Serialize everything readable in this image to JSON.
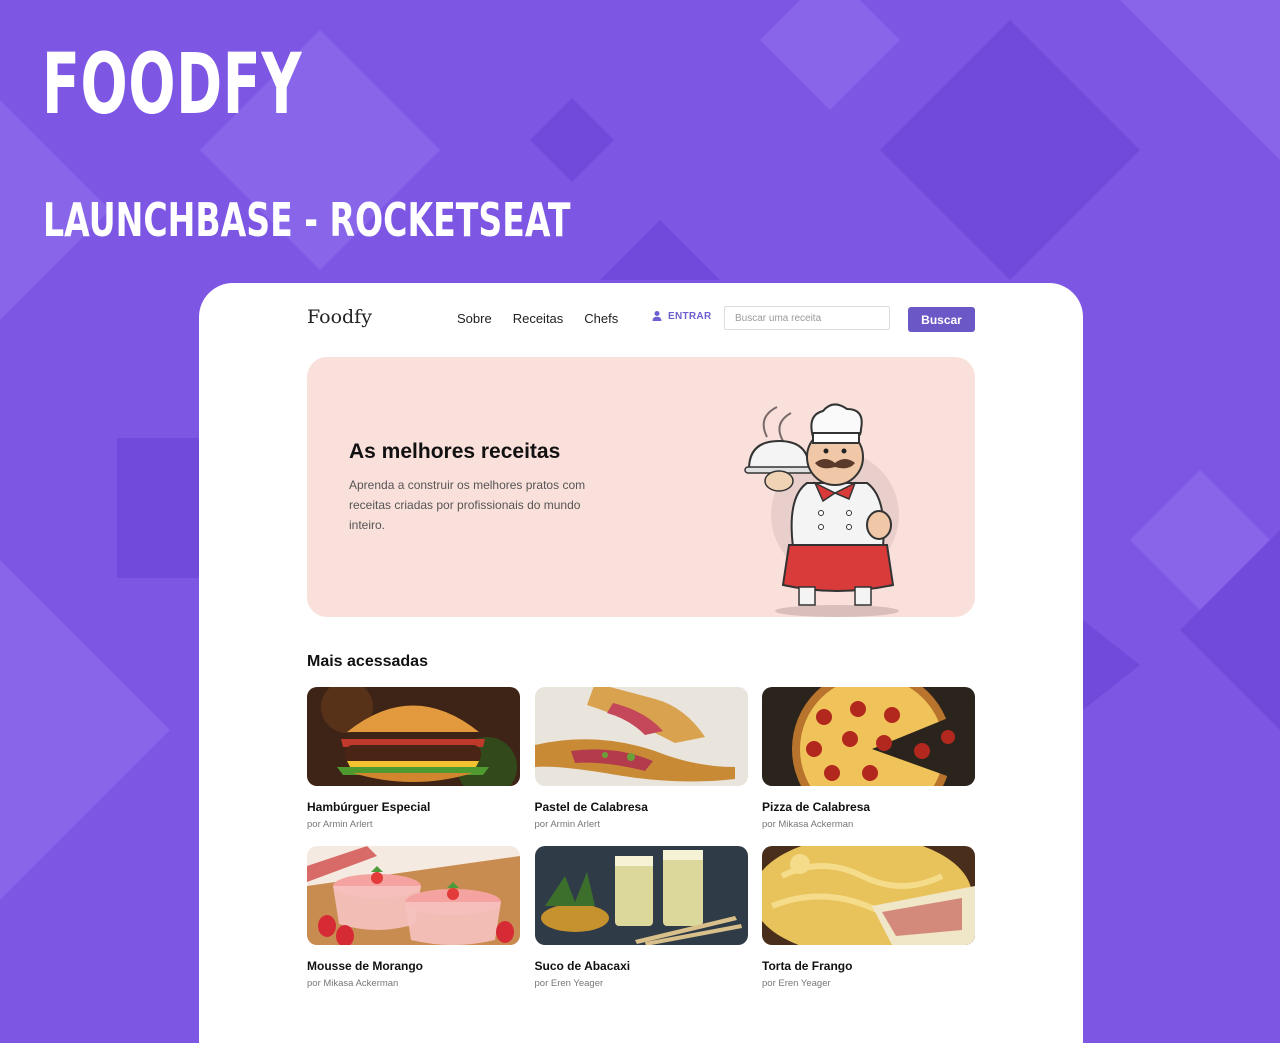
{
  "banner": {
    "title": "FOODFY",
    "subtitle": "LAUNCHBASE - ROCKETSEAT"
  },
  "header": {
    "logo": "Foodfy",
    "nav": [
      "Sobre",
      "Receitas",
      "Chefs"
    ],
    "login_label": "ENTRAR",
    "search_placeholder": "Buscar uma receita",
    "search_button": "Buscar"
  },
  "hero": {
    "title": "As melhores receitas",
    "description": "Aprenda a construir os melhores pratos com receitas criadas por profissionais do mundo inteiro."
  },
  "section_title": "Mais acessadas",
  "recipes": [
    {
      "title": "Hambúrguer Especial",
      "author": "por Armin Arlert"
    },
    {
      "title": "Pastel de Calabresa",
      "author": "por Armin Arlert"
    },
    {
      "title": "Pizza de Calabresa",
      "author": "por Mikasa Ackerman"
    },
    {
      "title": "Mousse de Morango",
      "author": "por Mikasa Ackerman"
    },
    {
      "title": "Suco de Abacaxi",
      "author": "por Eren Yeager"
    },
    {
      "title": "Torta de Frango",
      "author": "por Eren Yeager"
    }
  ],
  "colors": {
    "background": "#7d56e4",
    "accent": "#6c57c6",
    "hero_background": "#fae0db"
  }
}
